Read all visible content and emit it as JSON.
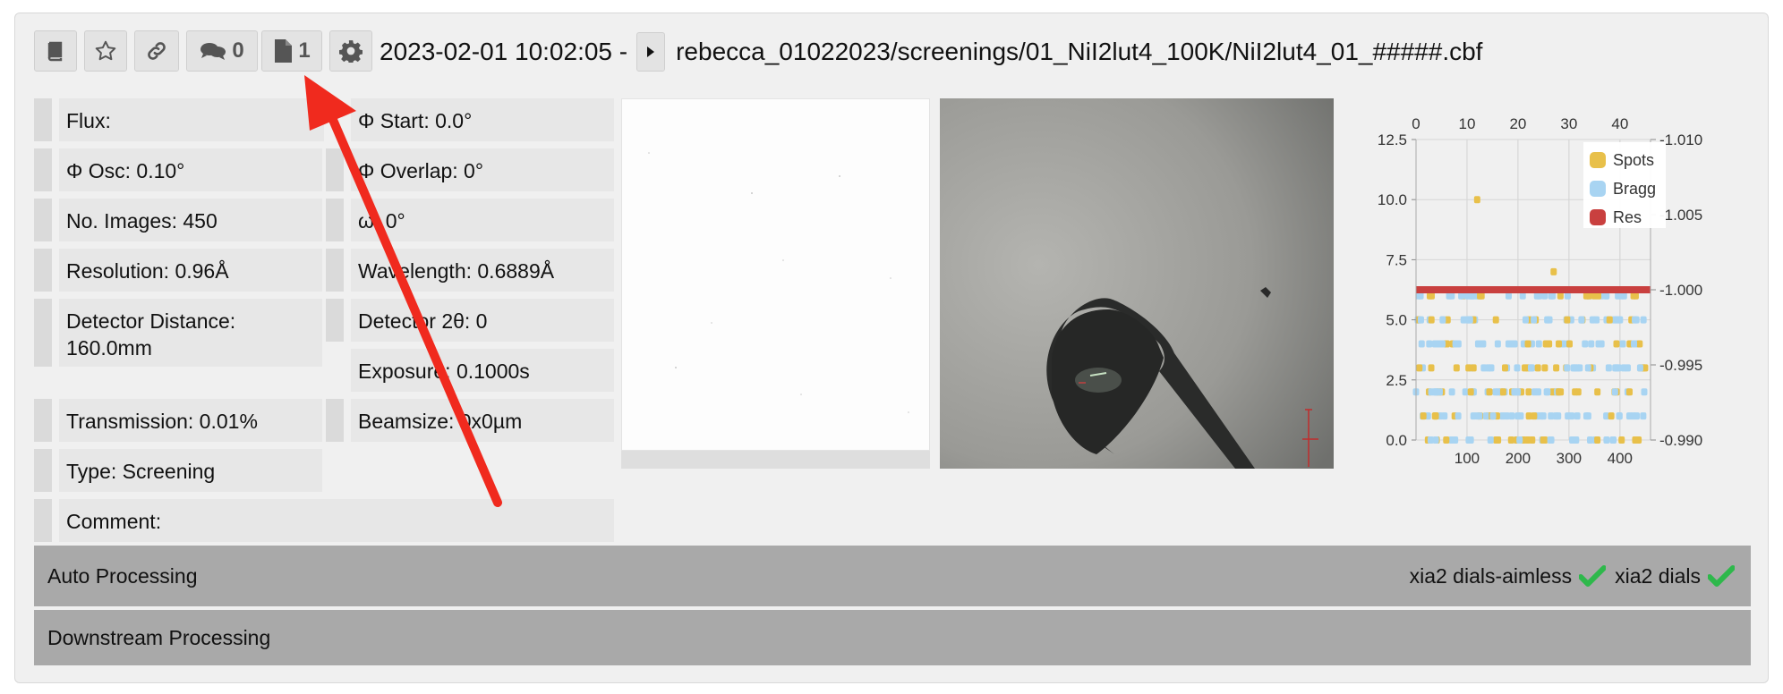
{
  "toolbar": {
    "comments_count": "0",
    "attachments_count": "1"
  },
  "heading": {
    "datetime": "2023-02-01 10:02:05 -",
    "path": "rebecca_01022023/screenings/01_NiI2lut4_100K/NiI2lut4_01_#####.cbf"
  },
  "params": {
    "flux": "Flux:",
    "phi_start": "Φ Start: 0.0°",
    "phi_osc": "Φ Osc: 0.10°",
    "phi_overlap": "Φ Overlap: 0°",
    "num_images": "No. Images: 450",
    "omega": "ω: 0°",
    "resolution": "Resolution: 0.96Å",
    "wavelength": "Wavelength: 0.6889Å",
    "detector_distance": "Detector Distance: 160.0mm",
    "detector_2theta": "Detector 2θ: 0",
    "exposure": "Exposure: 0.1000s",
    "transmission": "Transmission: 0.01%",
    "beamsize": "Beamsize: 0x0µm",
    "type": "Type: Screening",
    "comment": "Comment:"
  },
  "chart_data": {
    "type": "scatter",
    "x_bottom_ticks": [
      "100",
      "200",
      "300",
      "400"
    ],
    "x_top_ticks": [
      "0",
      "10",
      "20",
      "30",
      "40"
    ],
    "y_left_ticks": [
      "12.5",
      "10.0",
      "7.5",
      "5.0",
      "2.5",
      "0.0"
    ],
    "y_right_ticks": [
      "-1.010",
      "-1.005",
      "-1.000",
      "-0.995",
      "-0.990"
    ],
    "xlim": [
      0,
      460
    ],
    "ylim": [
      0,
      12.5
    ],
    "y_right_lim": [
      -1.01,
      -0.99
    ],
    "legend": [
      {
        "name": "Spots",
        "color": "#e8c04a"
      },
      {
        "name": "Bragg",
        "color": "#a8d4f2"
      },
      {
        "name": "Res",
        "color": "#c9403f"
      }
    ],
    "legend_placement": "top-right",
    "grid": true,
    "spots_outliers": [
      [
        120,
        10.0
      ],
      [
        270,
        7.0
      ]
    ],
    "res_value": -1.0,
    "rows": [
      0.0,
      1.0,
      2.0,
      3.0,
      4.0,
      5.0,
      6.0
    ]
  },
  "processing": {
    "auto_label": "Auto Processing",
    "downstream_label": "Downstream Processing",
    "pipelines": [
      "xia2 dials-aimless",
      "xia2 dials"
    ]
  },
  "colors": {
    "check": "#2eb84b",
    "arrow": "#f02a1e"
  }
}
